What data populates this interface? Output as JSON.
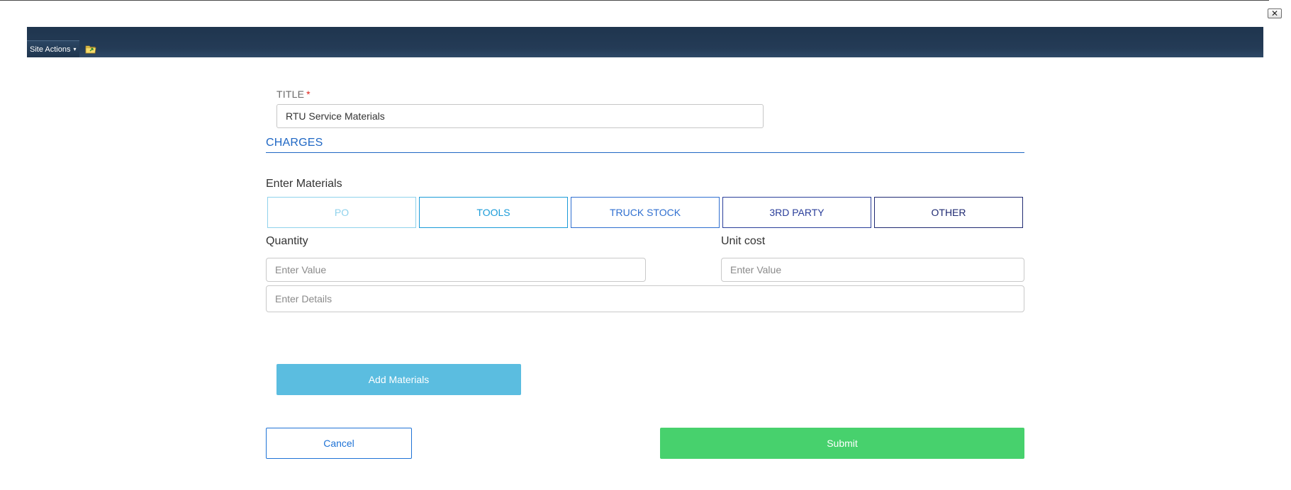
{
  "window": {
    "close_symbol": "✕",
    "close_icon": "close-icon"
  },
  "ribbon": {
    "site_actions_label": "Site Actions",
    "site_actions_caret": "▾",
    "nav_icon": "folder-navigate-icon"
  },
  "form": {
    "title_label": "TITLE",
    "required_marker": "*",
    "title_value": "RTU Service Materials",
    "section_title": "CHARGES",
    "materials_label": "Enter Materials",
    "material_types": [
      {
        "label": "PO",
        "color": "#8fd2ec"
      },
      {
        "label": "TOOLS",
        "color": "#1a9bd8"
      },
      {
        "label": "TRUCK STOCK",
        "color": "#2f6fd0"
      },
      {
        "label": "3RD PARTY",
        "color": "#2a3e9a"
      },
      {
        "label": "OTHER",
        "color": "#1f2a72"
      }
    ],
    "quantity_label": "Quantity",
    "quantity_value": "",
    "quantity_placeholder": "Enter Value",
    "unit_cost_label": "Unit cost",
    "unit_cost_value": "",
    "unit_cost_placeholder": "Enter Value",
    "details_value": "",
    "details_placeholder": "Enter Details"
  },
  "actions": {
    "add_materials_label": "Add Materials",
    "cancel_label": "Cancel",
    "submit_label": "Submit"
  },
  "colors": {
    "ribbon_bg": "#243b56",
    "accent_blue": "#1f67c4",
    "add_button": "#5bbde0",
    "submit_button": "#47d16d",
    "required": "#e2231a"
  }
}
